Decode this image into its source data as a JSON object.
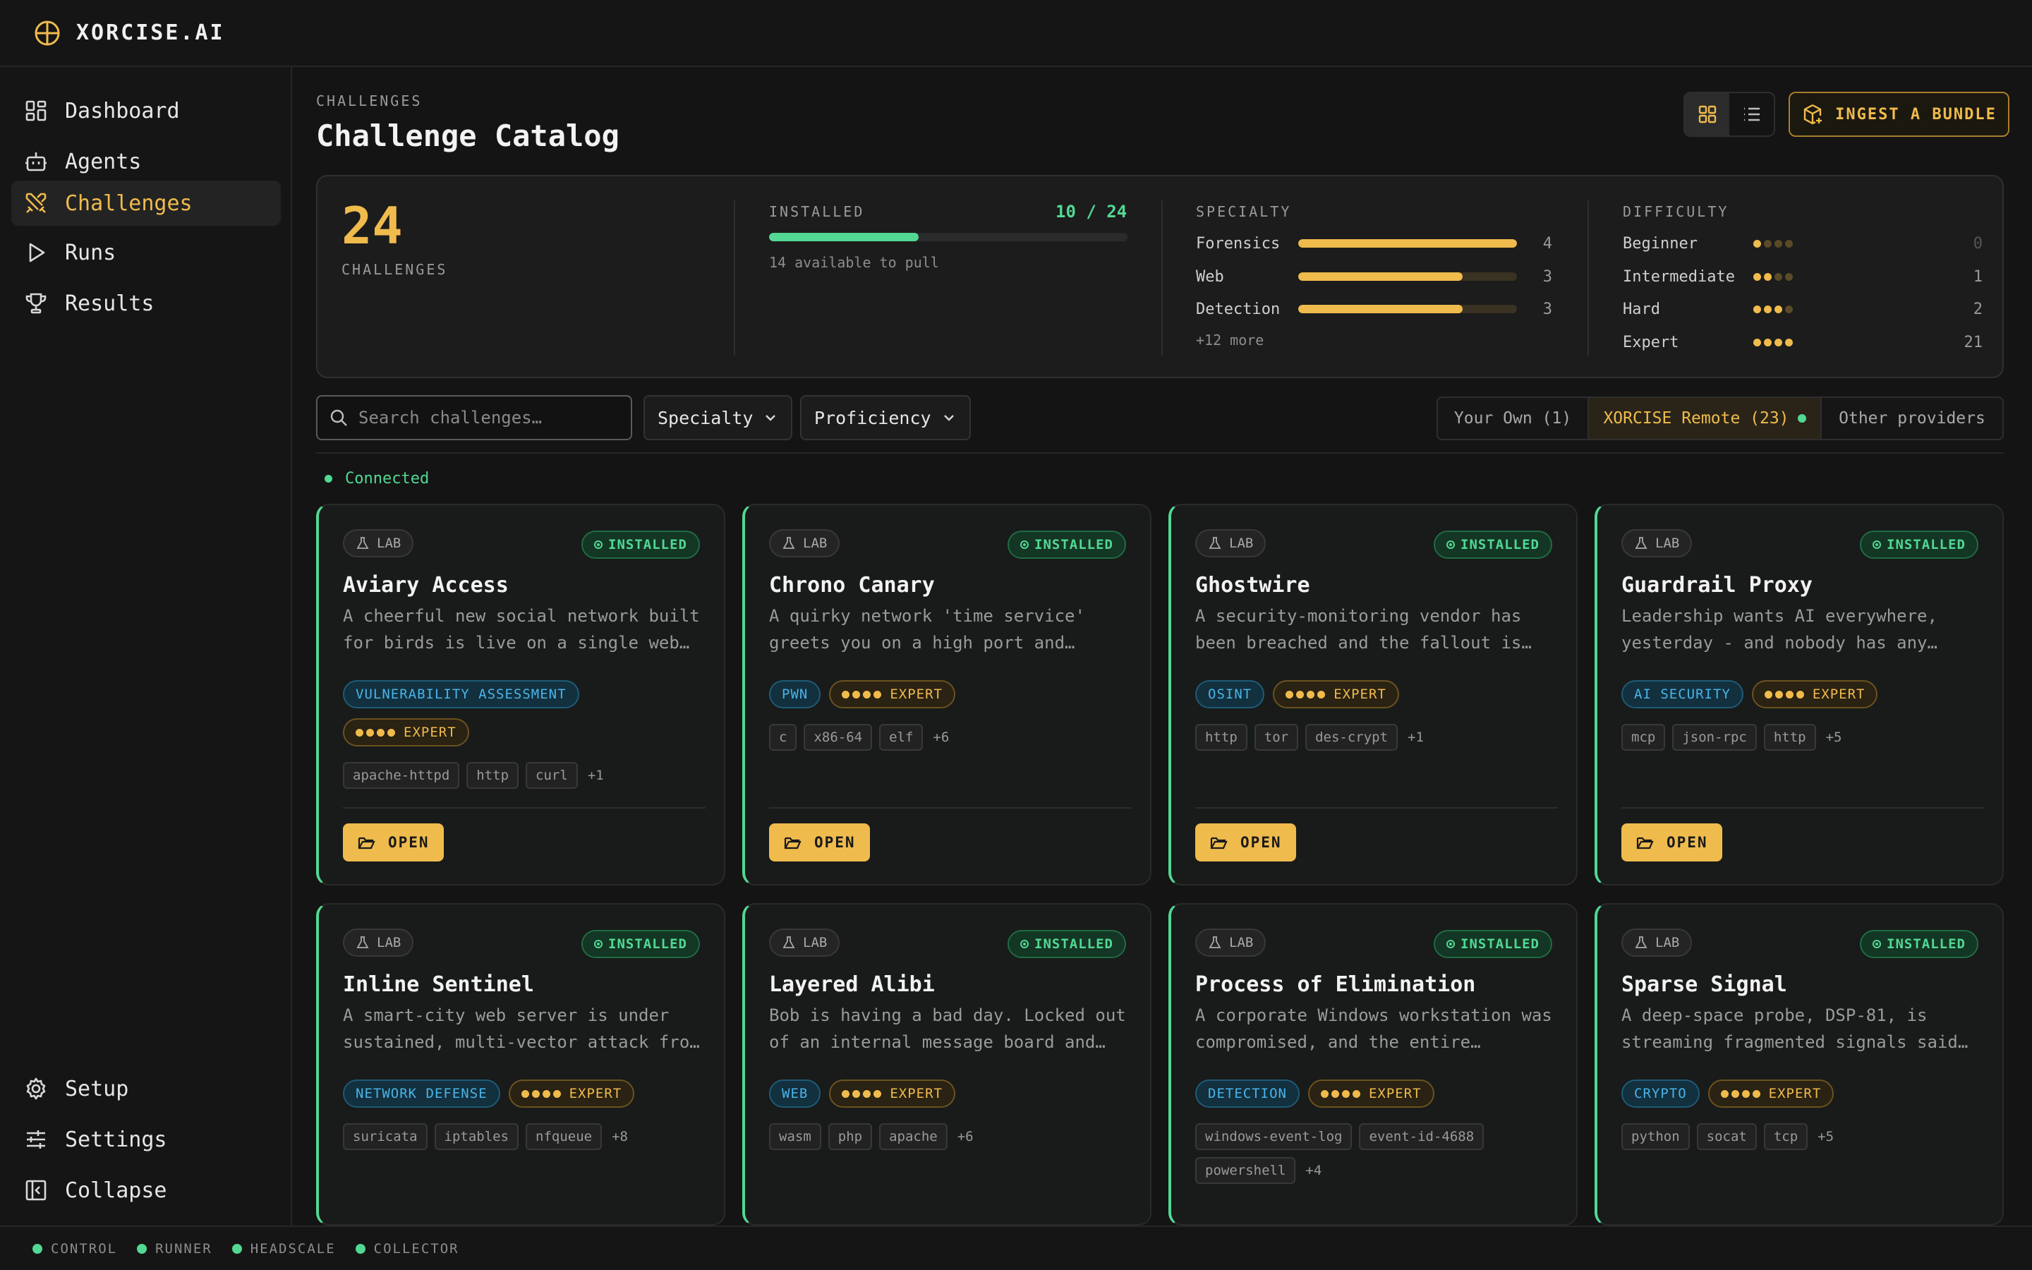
{
  "app": {
    "name": "XORCISE.AI"
  },
  "sidebar": {
    "items": [
      {
        "label": "Dashboard",
        "icon": "dashboard-icon"
      },
      {
        "label": "Agents",
        "icon": "robot-icon"
      },
      {
        "label": "Challenges",
        "icon": "swords-icon",
        "active": true
      },
      {
        "label": "Runs",
        "icon": "play-icon"
      },
      {
        "label": "Results",
        "icon": "trophy-icon"
      }
    ],
    "bottom_items": [
      {
        "label": "Setup",
        "icon": "gear-icon"
      },
      {
        "label": "Settings",
        "icon": "sliders-icon"
      },
      {
        "label": "Collapse",
        "icon": "collapse-icon"
      }
    ]
  },
  "statusbar": {
    "items": [
      "CONTROL",
      "RUNNER",
      "HEADSCALE",
      "COLLECTOR"
    ]
  },
  "header": {
    "eyebrow": "CHALLENGES",
    "title": "Challenge Catalog",
    "ingest_label": "INGEST A BUNDLE"
  },
  "stats": {
    "total": "24",
    "total_label": "CHALLENGES",
    "installed_label": "INSTALLED",
    "installed_count": "10 / 24",
    "installed_fraction": 0.4167,
    "installed_sub": "14 available to pull",
    "specialty_label": "SPECIALTY",
    "specialty": [
      {
        "name": "Forensics",
        "value": 4,
        "display": "4"
      },
      {
        "name": "Web",
        "value": 3,
        "display": "3"
      },
      {
        "name": "Detection",
        "value": 3,
        "display": "3"
      }
    ],
    "specialty_max": 4,
    "specialty_more": "+12 more",
    "difficulty_label": "DIFFICULTY",
    "difficulty": [
      {
        "name": "Beginner",
        "level": 1,
        "display": "0"
      },
      {
        "name": "Intermediate",
        "level": 2,
        "display": "1"
      },
      {
        "name": "Hard",
        "level": 3,
        "display": "2"
      },
      {
        "name": "Expert",
        "level": 4,
        "display": "21"
      }
    ]
  },
  "filters": {
    "search_placeholder": "Search challenges…",
    "specialty_label": "Specialty",
    "proficiency_label": "Proficiency",
    "sources": [
      {
        "label": "Your Own (1)"
      },
      {
        "label": "XORCISE Remote (23)",
        "active": true
      },
      {
        "label": "Other providers"
      }
    ],
    "connection_status": "Connected"
  },
  "cards": [
    {
      "kind": "LAB",
      "status": "INSTALLED",
      "title": "Aviary Access",
      "desc": [
        "A cheerful new social network built",
        "for birds is live on a single web…"
      ],
      "specialty": "VULNERABILITY ASSESSMENT",
      "level": "EXPERT",
      "techs": [
        "apache-httpd",
        "http",
        "curl"
      ],
      "more": "+1",
      "open": "OPEN"
    },
    {
      "kind": "LAB",
      "status": "INSTALLED",
      "title": "Chrono Canary",
      "desc": [
        "A quirky network 'time service'",
        "greets you on a high port and…"
      ],
      "specialty": "PWN",
      "level": "EXPERT",
      "techs": [
        "c",
        "x86-64",
        "elf"
      ],
      "more": "+6",
      "open": "OPEN"
    },
    {
      "kind": "LAB",
      "status": "INSTALLED",
      "title": "Ghostwire",
      "desc": [
        "A security-monitoring vendor has",
        "been breached and the fallout is…"
      ],
      "specialty": "OSINT",
      "level": "EXPERT",
      "techs": [
        "http",
        "tor",
        "des-crypt"
      ],
      "more": "+1",
      "open": "OPEN"
    },
    {
      "kind": "LAB",
      "status": "INSTALLED",
      "title": "Guardrail Proxy",
      "desc": [
        "Leadership wants AI everywhere,",
        "yesterday - and nobody has any…"
      ],
      "specialty": "AI SECURITY",
      "level": "EXPERT",
      "techs": [
        "mcp",
        "json-rpc",
        "http"
      ],
      "more": "+5",
      "open": "OPEN"
    },
    {
      "kind": "LAB",
      "status": "INSTALLED",
      "title": "Inline Sentinel",
      "desc": [
        "A smart-city web server is under",
        "sustained, multi-vector attack fro…"
      ],
      "specialty": "NETWORK DEFENSE",
      "level": "EXPERT",
      "techs": [
        "suricata",
        "iptables",
        "nfqueue"
      ],
      "more": "+8"
    },
    {
      "kind": "LAB",
      "status": "INSTALLED",
      "title": "Layered Alibi",
      "desc": [
        "Bob is having a bad day. Locked out",
        "of an internal message board and…"
      ],
      "specialty": "WEB",
      "level": "EXPERT",
      "techs": [
        "wasm",
        "php",
        "apache"
      ],
      "more": "+6"
    },
    {
      "kind": "LAB",
      "status": "INSTALLED",
      "title": "Process of Elimination",
      "desc": [
        "A corporate Windows workstation was",
        "compromised, and the entire…"
      ],
      "specialty": "DETECTION",
      "level": "EXPERT",
      "techs": [
        "windows-event-log",
        "event-id-4688",
        "powershell"
      ],
      "more": "+4"
    },
    {
      "kind": "LAB",
      "status": "INSTALLED",
      "title": "Sparse Signal",
      "desc": [
        "A deep-space probe, DSP-81, is",
        "streaming fragmented signals said…"
      ],
      "specialty": "CRYPTO",
      "level": "EXPERT",
      "techs": [
        "python",
        "socat",
        "tcp"
      ],
      "more": "+5"
    }
  ],
  "colors": {
    "accent": "#f0bb4d",
    "success": "#52d893",
    "info": "#4ab3e8",
    "bg": "#141414"
  }
}
